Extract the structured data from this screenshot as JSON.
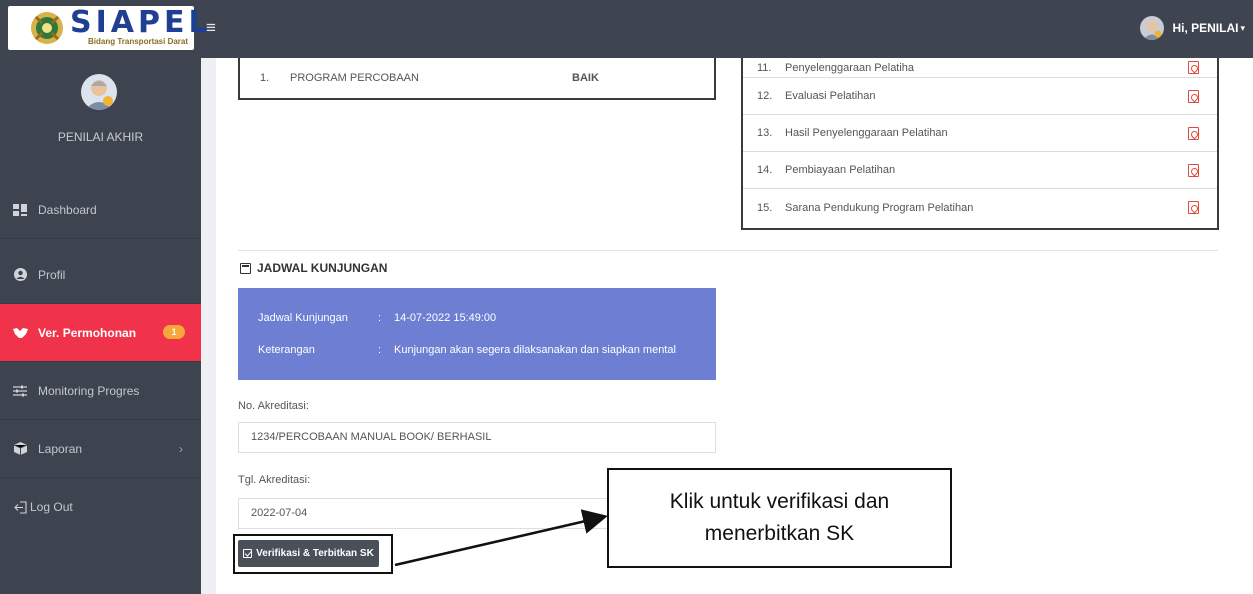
{
  "app": {
    "logo_title": "SIAPEL",
    "logo_subtitle": "Bidang Transportasi Darat",
    "user_greeting": "Hi, PENILAI",
    "menu_icon": "hamburger-icon"
  },
  "sidebar": {
    "role": "PENILAI AKHIR",
    "items": [
      {
        "label": "Dashboard",
        "icon": "dashboard-icon"
      },
      {
        "label": "Profil",
        "icon": "user-circle-icon"
      },
      {
        "label": "Ver. Permohonan",
        "icon": "handshake-icon",
        "badge": "1",
        "active": true
      },
      {
        "label": "Monitoring Progres",
        "icon": "sliders-icon"
      },
      {
        "label": "Laporan",
        "icon": "box-icon",
        "has_submenu": true
      },
      {
        "label": "Log Out",
        "icon": "logout-icon"
      }
    ]
  },
  "program_table": {
    "rows": [
      {
        "num": "1.",
        "name": "PROGRAM PERCOBAAN",
        "value": "BAIK"
      }
    ]
  },
  "documents": {
    "rows": [
      {
        "num": "11.",
        "name": "Penyelenggaraan Pelatiha"
      },
      {
        "num": "12.",
        "name": "Evaluasi Pelatihan"
      },
      {
        "num": "13.",
        "name": "Hasil Penyelenggaraan Pelatihan"
      },
      {
        "num": "14.",
        "name": "Pembiayaan Pelatihan"
      },
      {
        "num": "15.",
        "name": "Sarana Pendukung Program Pelatihan"
      }
    ],
    "icon": "pdf-icon"
  },
  "schedule": {
    "title": "JADWAL KUNJUNGAN",
    "date_label": "Jadwal Kunjungan",
    "date_value": "14-07-2022 15:49:00",
    "note_label": "Keterangan",
    "note_value": "Kunjungan akan segera dilaksanakan dan siapkan mental",
    "separator": ":"
  },
  "form": {
    "accreditation_no_label": "No. Akreditasi:",
    "accreditation_no_value": "1234/PERCOBAAN MANUAL BOOK/ BERHASIL",
    "accreditation_date_label": "Tgl. Akreditasi:",
    "accreditation_date_value": "2022-07-04",
    "verify_button": "Verifikasi & Terbitkan SK"
  },
  "annotation": {
    "line1": "Klik untuk verifikasi dan",
    "line2": "menerbitkan SK"
  },
  "colors": {
    "topbar": "#3e4450",
    "sidebar": "#3d434f",
    "active": "#f0334b",
    "badge": "#f4a83a",
    "visit_box": "#6e7fd3",
    "brand_blue": "#1f3f93",
    "pdf_red": "#e0493b"
  }
}
